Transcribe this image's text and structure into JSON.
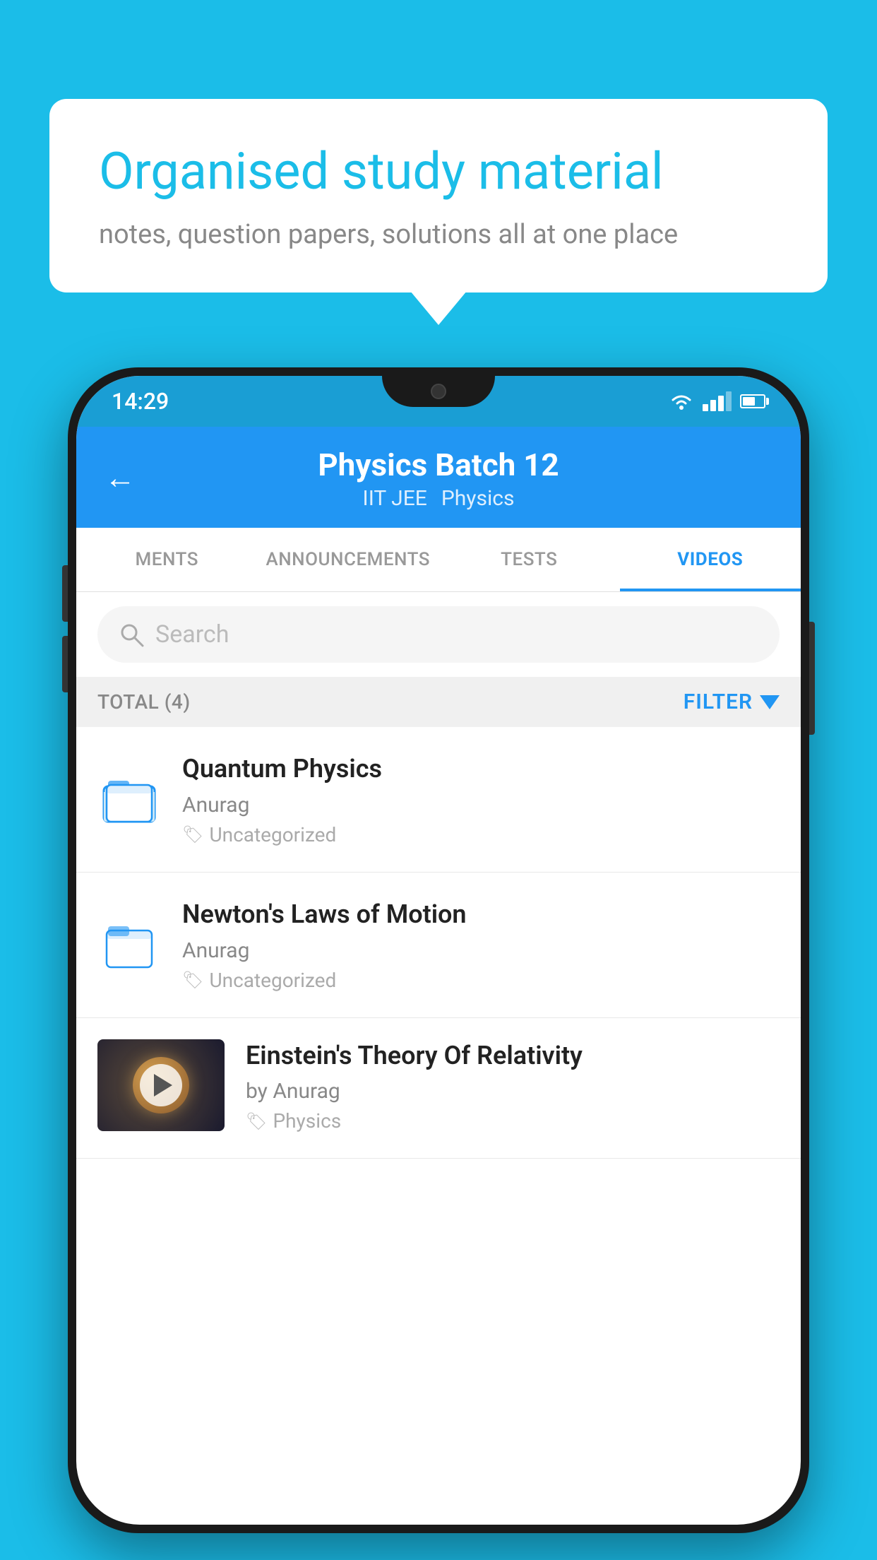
{
  "background_color": "#1bbde8",
  "speech_bubble": {
    "title": "Organised study material",
    "subtitle": "notes, question papers, solutions all at one place"
  },
  "phone": {
    "status_bar": {
      "time": "14:29"
    },
    "header": {
      "title": "Physics Batch 12",
      "subtitle_part1": "IIT JEE",
      "subtitle_part2": "Physics",
      "back_label": "←"
    },
    "tabs": [
      {
        "label": "MENTS",
        "active": false
      },
      {
        "label": "ANNOUNCEMENTS",
        "active": false
      },
      {
        "label": "TESTS",
        "active": false
      },
      {
        "label": "VIDEOS",
        "active": true
      }
    ],
    "search": {
      "placeholder": "Search"
    },
    "filter": {
      "total_label": "TOTAL (4)",
      "filter_label": "FILTER"
    },
    "videos": [
      {
        "id": 1,
        "title": "Quantum Physics",
        "author": "Anurag",
        "tag": "Uncategorized",
        "type": "folder",
        "has_thumbnail": false
      },
      {
        "id": 2,
        "title": "Newton's Laws of Motion",
        "author": "Anurag",
        "tag": "Uncategorized",
        "type": "folder",
        "has_thumbnail": false
      },
      {
        "id": 3,
        "title": "Einstein's Theory Of Relativity",
        "author": "by Anurag",
        "tag": "Physics",
        "type": "video",
        "has_thumbnail": true
      }
    ]
  }
}
